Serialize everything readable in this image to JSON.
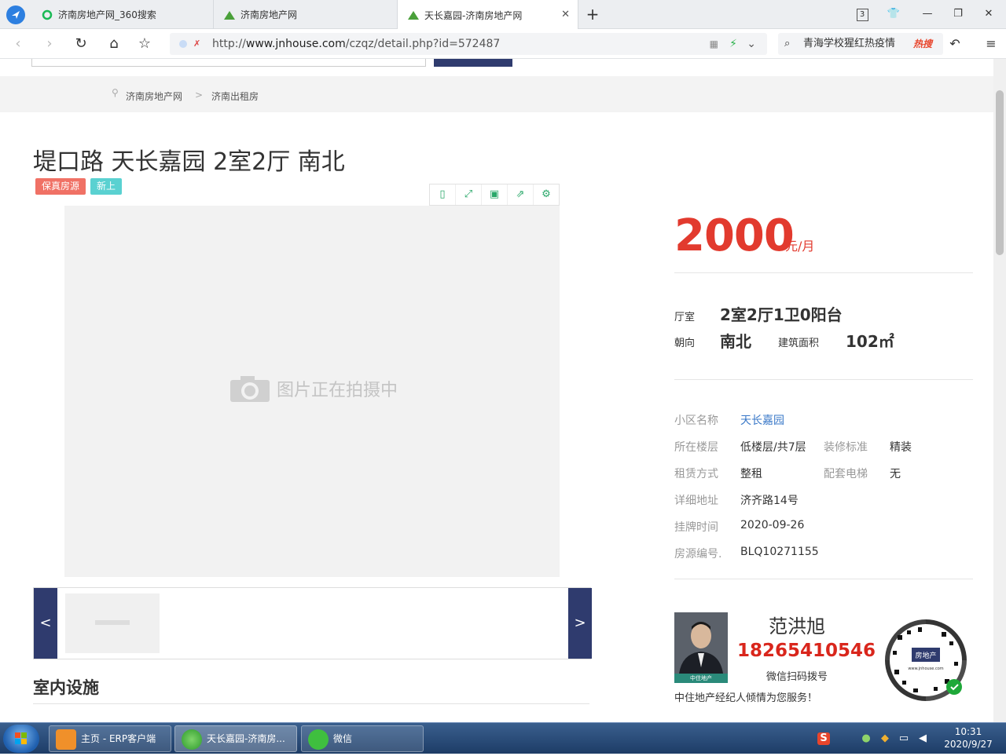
{
  "browser": {
    "tabs": [
      {
        "label": "济南房地产网_360搜索",
        "active": false
      },
      {
        "label": "济南房地产网",
        "active": false
      },
      {
        "label": "天长嘉园-济南房地产网",
        "active": true
      }
    ],
    "tab_count_badge": "3",
    "url_prefix": "http://",
    "url_domain": "www.jnhouse.com",
    "url_path": "/czqz/detail.php?id=572487",
    "search_text": "青海学校猩红热疫情",
    "hot_label": "热搜"
  },
  "breadcrumb": [
    "济南房地产网",
    "济南出租房"
  ],
  "listing": {
    "title": "堤口路 天长嘉园 2室2厅 南北",
    "tags": [
      {
        "label": "保真房源",
        "color": "#f07165"
      },
      {
        "label": "新上",
        "color": "#5ad1d1"
      }
    ],
    "photo_placeholder": "图片正在拍摄中",
    "price": "2000",
    "price_unit": "元/月",
    "layout_label": "厅室",
    "layout_value": "2室2厅1卫0阳台",
    "orientation_label": "朝向",
    "orientation_value": "南北",
    "area_label": "建筑面积",
    "area_value": "102㎡",
    "details": {
      "community_label": "小区名称",
      "community_value": "天长嘉园",
      "floor_label": "所在楼层",
      "floor_value": "低楼层/共7层",
      "decoration_label": "装修标准",
      "decoration_value": "精装",
      "rent_label": "租赁方式",
      "rent_value": "整租",
      "elevator_label": "配套电梯",
      "elevator_value": "无",
      "address_label": "详细地址",
      "address_value": "济齐路14号",
      "listed_label": "挂牌时间",
      "listed_value": "2020-09-26",
      "code_label": "房源编号.",
      "code_value": "BLQ10271155"
    },
    "facilities_heading": "室内设施"
  },
  "agent": {
    "name": "范洪旭",
    "phone": "18265410546",
    "hint": "微信扫码拨号",
    "slogan": "中住地产经纪人倾情为您服务！",
    "badge": "中住地产"
  },
  "taskbar": {
    "items": [
      {
        "label": "主页 - ERP客户端"
      },
      {
        "label": "天长嘉园-济南房..."
      },
      {
        "label": "微信"
      }
    ],
    "time": "10:31",
    "date": "2020/9/27"
  },
  "colors": {
    "accent_red": "#e23a2e",
    "nav_blue": "#2f3b6e",
    "link_blue": "#3a78c8"
  }
}
